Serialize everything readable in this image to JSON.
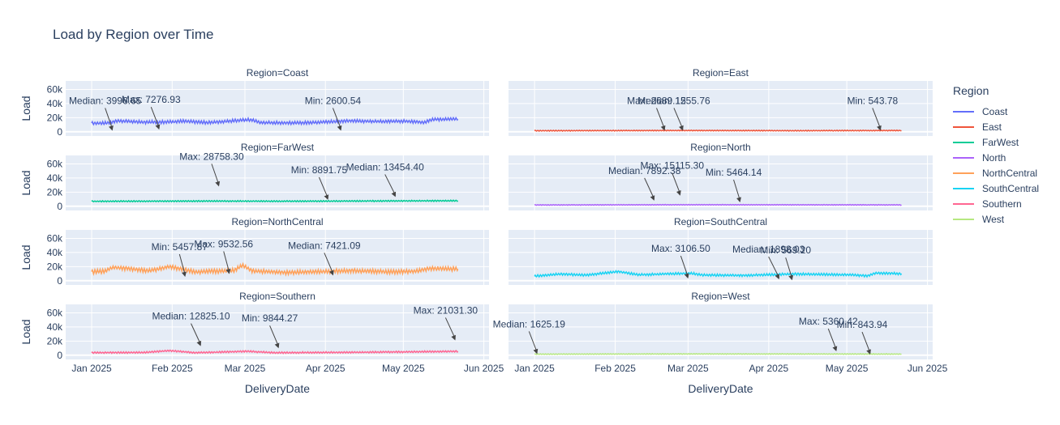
{
  "title": "Load by Region over Time",
  "legend": {
    "title": "Region",
    "items": [
      {
        "name": "Coast",
        "color": "#636efa"
      },
      {
        "name": "East",
        "color": "#EF553B"
      },
      {
        "name": "FarWest",
        "color": "#00cc96"
      },
      {
        "name": "North",
        "color": "#ab63fa"
      },
      {
        "name": "NorthCentral",
        "color": "#FFA15A"
      },
      {
        "name": "SouthCentral",
        "color": "#19d3f3"
      },
      {
        "name": "Southern",
        "color": "#FF6692"
      },
      {
        "name": "West",
        "color": "#B6E880"
      }
    ]
  },
  "chart_data": {
    "type": "line",
    "xlabel": "DeliveryDate",
    "ylabel": "Load",
    "x_range": [
      "2024-12-22",
      "2025-06-03"
    ],
    "x_ticks": [
      {
        "date": "2025-01-01",
        "label": "Jan 2025"
      },
      {
        "date": "2025-02-01",
        "label": "Feb 2025"
      },
      {
        "date": "2025-03-01",
        "label": "Mar 2025"
      },
      {
        "date": "2025-04-01",
        "label": "Apr 2025"
      },
      {
        "date": "2025-05-01",
        "label": "May 2025"
      },
      {
        "date": "2025-06-01",
        "label": "Jun 2025"
      }
    ],
    "ylim": [
      -6000,
      72000
    ],
    "y_ticks": [
      0,
      20000,
      40000,
      60000
    ],
    "y_tick_labels": [
      "0",
      "20k",
      "40k",
      "60k"
    ],
    "data_start": "2025-01-01",
    "data_end": "2025-05-22",
    "panels": [
      {
        "title": "Region=Coast",
        "series": "Coast",
        "color": "#636efa",
        "profile": [
          [
            0,
            12000
          ],
          [
            6,
            12500
          ],
          [
            10,
            15500
          ],
          [
            20,
            13500
          ],
          [
            30,
            14000
          ],
          [
            35,
            15000
          ],
          [
            45,
            13000
          ],
          [
            60,
            17000
          ],
          [
            62,
            16500
          ],
          [
            65,
            13000
          ],
          [
            80,
            12500
          ],
          [
            100,
            15500
          ],
          [
            110,
            14500
          ],
          [
            120,
            15000
          ],
          [
            125,
            14000
          ],
          [
            128,
            13500
          ],
          [
            131,
            17500
          ],
          [
            141,
            18000
          ]
        ],
        "noise": 1800,
        "annotations": [
          {
            "text": "Median: 3996.65",
            "date": "2025-01-09",
            "y": 1500,
            "ax": -9,
            "ay": -30
          },
          {
            "text": "Max: 7276.93",
            "date": "2025-01-27",
            "y": 3000,
            "ax": -10,
            "ay": -30
          },
          {
            "text": "Min: 2600.54",
            "date": "2025-04-07",
            "y": 1500,
            "ax": -10,
            "ay": -30
          }
        ]
      },
      {
        "title": "Region=East",
        "series": "East",
        "color": "#EF553B",
        "profile": [
          [
            0,
            1500
          ],
          [
            60,
            1800
          ],
          [
            100,
            1500
          ],
          [
            141,
            1800
          ]
        ],
        "noise": 500,
        "annotations": [
          {
            "text": "Max: 2689.15",
            "date": "2025-02-20",
            "y": 1500,
            "ax": -10,
            "ay": -30
          },
          {
            "text": "Median: 1255.76",
            "date": "2025-02-27",
            "y": 1500,
            "ax": -11,
            "ay": -30
          },
          {
            "text": "Min: 543.78",
            "date": "2025-05-14",
            "y": 1500,
            "ax": -10,
            "ay": -30
          }
        ]
      },
      {
        "title": "Region=FarWest",
        "series": "FarWest",
        "color": "#00cc96",
        "profile": [
          [
            0,
            7000
          ],
          [
            40,
            7300
          ],
          [
            80,
            7100
          ],
          [
            141,
            7800
          ]
        ],
        "noise": 700,
        "annotations": [
          {
            "text": "Max: 28758.30",
            "date": "2025-02-19",
            "y": 28000,
            "ax": -9,
            "ay": -30
          },
          {
            "text": "Min: 8891.75",
            "date": "2025-04-02",
            "y": 9000,
            "ax": -11,
            "ay": -30
          },
          {
            "text": "Median: 13454.40",
            "date": "2025-04-28",
            "y": 13000,
            "ax": -13,
            "ay": -30
          }
        ]
      },
      {
        "title": "Region=North",
        "series": "North",
        "color": "#ab63fa",
        "profile": [
          [
            0,
            1800
          ],
          [
            60,
            2100
          ],
          [
            141,
            1900
          ]
        ],
        "noise": 400,
        "annotations": [
          {
            "text": "Median: 7892.38",
            "date": "2025-02-16",
            "y": 7900,
            "ax": -12,
            "ay": -30
          },
          {
            "text": "Max: 15115.30",
            "date": "2025-02-26",
            "y": 15000,
            "ax": -10,
            "ay": -30
          },
          {
            "text": "Min: 5464.14",
            "date": "2025-03-21",
            "y": 5500,
            "ax": -8,
            "ay": -30
          }
        ]
      },
      {
        "title": "Region=NorthCentral",
        "series": "NorthCentral",
        "color": "#FFA15A",
        "profile": [
          [
            0,
            12500
          ],
          [
            5,
            13500
          ],
          [
            8,
            19000
          ],
          [
            15,
            17000
          ],
          [
            22,
            14000
          ],
          [
            30,
            20000
          ],
          [
            40,
            12500
          ],
          [
            52,
            14000
          ],
          [
            55,
            15000
          ],
          [
            58,
            22000
          ],
          [
            62,
            14000
          ],
          [
            75,
            11500
          ],
          [
            90,
            13000
          ],
          [
            100,
            14500
          ],
          [
            115,
            12500
          ],
          [
            125,
            13500
          ],
          [
            130,
            17500
          ],
          [
            141,
            16500
          ]
        ],
        "noise": 2400,
        "annotations": [
          {
            "text": "Min: 5457.87",
            "date": "2025-02-06",
            "y": 5500,
            "ax": -7,
            "ay": -30
          },
          {
            "text": "Max: 9532.56",
            "date": "2025-02-23",
            "y": 9500,
            "ax": -7,
            "ay": -30
          },
          {
            "text": "Median: 7421.09",
            "date": "2025-04-04",
            "y": 7400,
            "ax": -11,
            "ay": -30
          }
        ]
      },
      {
        "title": "Region=SouthCentral",
        "series": "SouthCentral",
        "color": "#19d3f3",
        "profile": [
          [
            0,
            6500
          ],
          [
            10,
            9500
          ],
          [
            20,
            8000
          ],
          [
            32,
            13000
          ],
          [
            40,
            8500
          ],
          [
            60,
            10500
          ],
          [
            65,
            8000
          ],
          [
            80,
            7500
          ],
          [
            100,
            9500
          ],
          [
            120,
            8500
          ],
          [
            128,
            7000
          ],
          [
            131,
            11000
          ],
          [
            141,
            10000
          ]
        ],
        "noise": 1300,
        "annotations": [
          {
            "text": "Max: 3106.50",
            "date": "2025-03-01",
            "y": 3100,
            "ax": -9,
            "ay": -30
          },
          {
            "text": "Median: 1898.03",
            "date": "2025-04-05",
            "y": 1900,
            "ax": -13,
            "ay": -30
          },
          {
            "text": "Min: 569.20",
            "date": "2025-04-10",
            "y": 600,
            "ax": -8,
            "ay": -30
          }
        ]
      },
      {
        "title": "Region=Southern",
        "series": "Southern",
        "color": "#FF6692",
        "profile": [
          [
            0,
            3500
          ],
          [
            20,
            3800
          ],
          [
            30,
            6500
          ],
          [
            40,
            3500
          ],
          [
            60,
            5500
          ],
          [
            70,
            3500
          ],
          [
            100,
            4000
          ],
          [
            130,
            5000
          ],
          [
            141,
            5500
          ]
        ],
        "noise": 900,
        "annotations": [
          {
            "text": "Median: 12825.10",
            "date": "2025-02-12",
            "y": 12800,
            "ax": -12,
            "ay": -30
          },
          {
            "text": "Min: 9844.27",
            "date": "2025-03-14",
            "y": 9800,
            "ax": -11,
            "ay": -30
          },
          {
            "text": "Max: 21031.30",
            "date": "2025-05-21",
            "y": 21000,
            "ax": -12,
            "ay": -30
          }
        ]
      },
      {
        "title": "Region=West",
        "series": "West",
        "color": "#B6E880",
        "profile": [
          [
            0,
            1500
          ],
          [
            60,
            1800
          ],
          [
            141,
            1600
          ]
        ],
        "noise": 400,
        "annotations": [
          {
            "text": "Median: 1625.19",
            "date": "2025-01-02",
            "y": 1600,
            "ax": -10,
            "ay": -30
          },
          {
            "text": "Max: 5360.42",
            "date": "2025-04-27",
            "y": 5400,
            "ax": -10,
            "ay": -30
          },
          {
            "text": "Min: 843.94",
            "date": "2025-05-10",
            "y": 850,
            "ax": -10,
            "ay": -30
          }
        ]
      }
    ]
  }
}
